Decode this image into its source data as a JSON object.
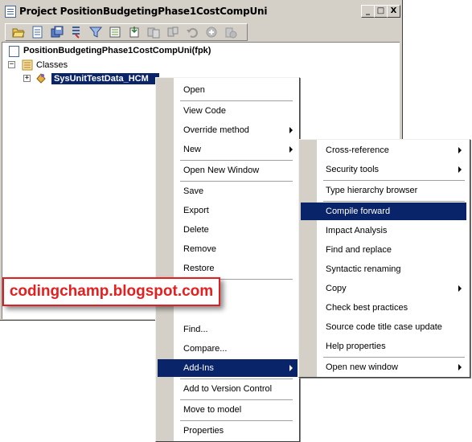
{
  "window": {
    "title": "Project PositionBudgetingPhase1CostCompUni",
    "controls": {
      "minimize": "_",
      "maximize": "□",
      "close": "X"
    }
  },
  "toolbar": {
    "buttons": [
      "open-icon",
      "properties-icon",
      "save-all-icon",
      "compile-icon",
      "filter-icon",
      "new-icon",
      "import-icon",
      "duplicate-icon",
      "version-control-icon",
      "undo-icon",
      "refresh-icon",
      "delete-icon"
    ]
  },
  "tree": {
    "project": "PositionBudgetingPhase1CostCompUni(fpk)",
    "classes": "Classes",
    "selected_node": "SysUnitTestData_HCM"
  },
  "context_menu": {
    "items": [
      "Open",
      "View Code",
      "Override method",
      "New",
      "Open New Window",
      "Save",
      "Export",
      "Delete",
      "Remove",
      "Restore",
      "Find...",
      "Compare...",
      "Add-Ins",
      "Add to Version Control",
      "Move to model",
      "Properties"
    ]
  },
  "submenu": {
    "items": [
      "Cross-reference",
      "Security tools",
      "Type hierarchy browser",
      "Compile forward",
      "Impact Analysis",
      "Find and replace",
      "Syntactic renaming",
      "Copy",
      "Check best practices",
      "Source code title case update",
      "Help properties",
      "Open new window"
    ]
  },
  "watermark": {
    "text": "codingchamp.blogspot.com"
  },
  "colors": {
    "selection": "#0a246a",
    "chrome": "#d4d0c8",
    "watermark": "#e41f1f"
  }
}
